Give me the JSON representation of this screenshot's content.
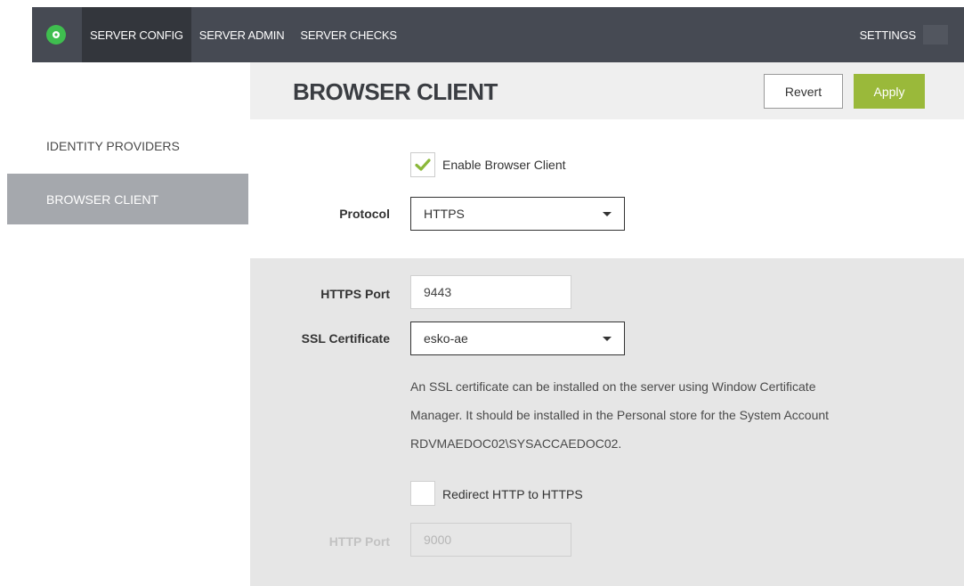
{
  "topbar": {
    "logo_icon": "gear-icon",
    "nav": [
      {
        "label": "SERVER CONFIG",
        "active": true
      },
      {
        "label": "SERVER ADMIN",
        "active": false
      },
      {
        "label": "SERVER CHECKS",
        "active": false
      }
    ],
    "settings_label": "SETTINGS"
  },
  "sidebar": {
    "items": [
      {
        "label": "IDENTITY PROVIDERS",
        "active": false
      },
      {
        "label": "BROWSER CLIENT",
        "active": true
      }
    ]
  },
  "header": {
    "title": "BROWSER CLIENT",
    "revert_label": "Revert",
    "apply_label": "Apply"
  },
  "form": {
    "enable_label": "Enable Browser Client",
    "enable_checked": true,
    "protocol_label": "Protocol",
    "protocol_value": "HTTPS",
    "https_port_label": "HTTPS Port",
    "https_port_value": "9443",
    "ssl_label": "SSL Certificate",
    "ssl_value": "esko-ae",
    "help_lines": [
      "An SSL certificate can be installed on the server using Window Certificate",
      "Manager. It should be installed in the Personal store for the System Account",
      "RDVMAEDOC02\\SYSACCAEDOC02."
    ],
    "redirect_label": "Redirect HTTP to HTTPS",
    "redirect_checked": false,
    "http_port_label": "HTTP Port",
    "http_port_value": "9000"
  },
  "colors": {
    "topbar": "#464a53",
    "accent_green": "#9ab93a",
    "logo_green": "#3fbe4f",
    "sidebar_active": "#a5a8ad"
  }
}
